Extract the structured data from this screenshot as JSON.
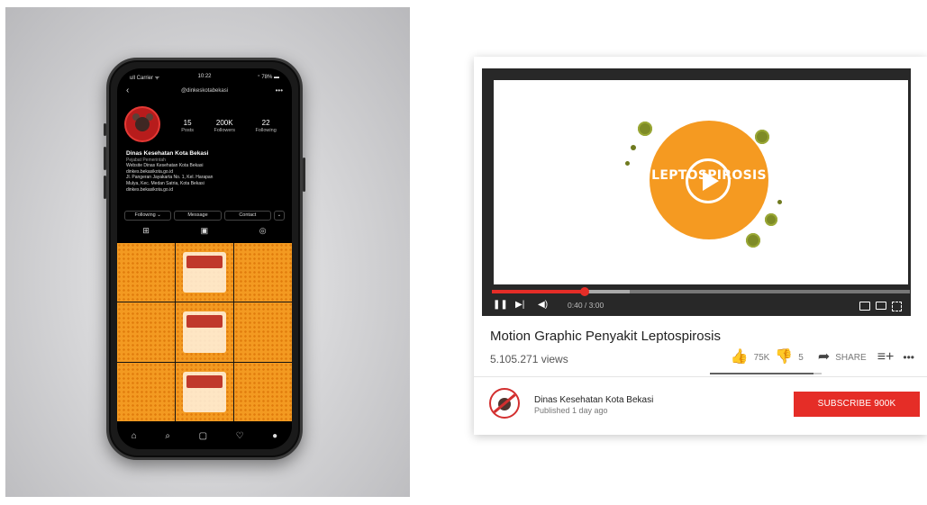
{
  "phone": {
    "status": {
      "carrier": "ull Carrier ᯤ",
      "time": "10:22",
      "right": "⁺ 78% ▬"
    },
    "username": "@dinkeskotabekasi",
    "stats": [
      {
        "number": "15",
        "label": "Posts"
      },
      {
        "number": "200K",
        "label": "Followers"
      },
      {
        "number": "22",
        "label": "Following"
      }
    ],
    "bio": {
      "name": "Dinas Kesehatan Kota Bekasi",
      "category": "Pejabat Pemerintah",
      "lines": [
        "Website Dinas Kesehatan Kota Bekasi",
        "dinkes.bekasikota.go.id",
        "Jl. Pangeran Jayakarta No. 1, Kel. Harapan",
        "Mulya, Kec. Medan Satria, Kota Bekasi",
        "dinkes.bekasikota.go.id"
      ]
    },
    "buttons": {
      "following": "Following ⌄",
      "message": "Message",
      "contact": "Contact",
      "dropdown": "⌄"
    },
    "tabs": {
      "grid": "⊞",
      "reels": "▣",
      "tagged": "◎"
    },
    "nav": {
      "home": "⌂",
      "search": "⌕",
      "reels": "▢",
      "activity": "♡",
      "profile": "●"
    }
  },
  "video": {
    "overlay_text": "LEPTOSPIROSIS",
    "progress_fraction": 0.222,
    "buffer_fraction": 0.33,
    "time": "0:40 / 3:00",
    "controls": {
      "pause": "❚❚",
      "next": "▶|",
      "volume": "◀)"
    },
    "title": "Motion Graphic Penyakit Leptospirosis",
    "views": "5.105.271 views",
    "likes": "75K",
    "dislikes": "5",
    "like_ratio": 0.93,
    "share_label": "SHARE",
    "channel_name": "Dinas Kesehatan Kota Bekasi",
    "published": "Published 1 day ago",
    "subscribe_label": "SUBSCRIBE 900K",
    "icons": {
      "like": "👍",
      "dislike": "👎",
      "share": "➦",
      "add": "≡+",
      "more": "•••"
    }
  },
  "colors": {
    "accent": "#e52d27",
    "orange": "#f59a21",
    "germ": "#7e8b26"
  }
}
